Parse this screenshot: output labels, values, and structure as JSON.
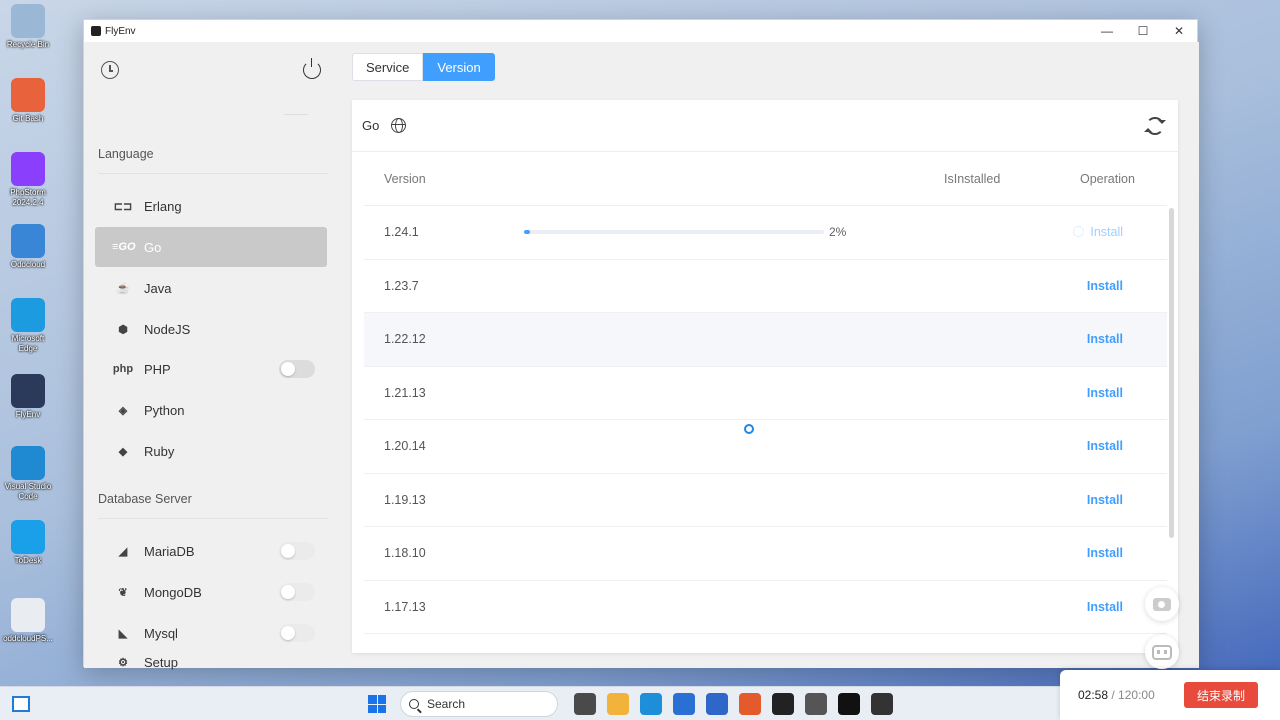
{
  "desktop": {
    "icons": [
      {
        "label": "Recycle Bin",
        "icon": "recycle-bin-icon",
        "color": "#9ab7d6"
      },
      {
        "label": "Git Bash",
        "icon": "git-bash-icon",
        "color": "#e8633b"
      },
      {
        "label": "PhpStorm 2024.2.4",
        "icon": "phpstorm-icon",
        "color": "#8a3ffc"
      },
      {
        "label": "Oddcloud",
        "icon": "oddcloud-icon",
        "color": "#3a86d6"
      },
      {
        "label": "Microsoft Edge",
        "icon": "edge-icon",
        "color": "#1c9be0"
      },
      {
        "label": "FlyEnv",
        "icon": "flyenv-icon",
        "color": "#2b3a5a"
      },
      {
        "label": "Visual Studio Code",
        "icon": "vscode-icon",
        "color": "#1f8ad2"
      },
      {
        "label": "ToDesk",
        "icon": "todesk-icon",
        "color": "#1aa0e8"
      },
      {
        "label": "oddcloudPS...",
        "icon": "file-icon",
        "color": "#e9edf2"
      }
    ]
  },
  "window": {
    "title": "FlyEnv",
    "controls": {
      "minimize": "—",
      "maximize": "☐",
      "close": "✕"
    }
  },
  "sidebar": {
    "sections": [
      {
        "title": "Language",
        "items": [
          {
            "label": "Erlang",
            "icon": "erlang-icon",
            "glyph": "⊏⊐",
            "active": false,
            "toggle": false
          },
          {
            "label": "Go",
            "icon": "go-icon",
            "glyph": "≡GO",
            "active": true,
            "toggle": false
          },
          {
            "label": "Java",
            "icon": "java-icon",
            "glyph": "☕",
            "active": false,
            "toggle": false
          },
          {
            "label": "NodeJS",
            "icon": "nodejs-icon",
            "glyph": "⬢",
            "active": false,
            "toggle": false
          },
          {
            "label": "PHP",
            "icon": "php-icon",
            "glyph": "php",
            "active": false,
            "toggle": true
          },
          {
            "label": "Python",
            "icon": "python-icon",
            "glyph": "◈",
            "active": false,
            "toggle": false
          },
          {
            "label": "Ruby",
            "icon": "ruby-icon",
            "glyph": "◆",
            "active": false,
            "toggle": false
          }
        ]
      },
      {
        "title": "Database Server",
        "items": [
          {
            "label": "MariaDB",
            "icon": "mariadb-icon",
            "glyph": "◢",
            "toggle": true
          },
          {
            "label": "MongoDB",
            "icon": "mongodb-icon",
            "glyph": "❦",
            "toggle": true
          },
          {
            "label": "Mysql",
            "icon": "mysql-icon",
            "glyph": "◣",
            "toggle": true
          }
        ]
      }
    ],
    "setup_label": "Setup"
  },
  "main": {
    "tabs": [
      {
        "label": "Service",
        "active": false
      },
      {
        "label": "Version",
        "active": true
      }
    ],
    "card": {
      "title": "Go",
      "columns": {
        "version": "Version",
        "installed": "IsInstalled",
        "operation": "Operation"
      },
      "rows": [
        {
          "version": "1.24.1",
          "progress": 2,
          "progress_label": "2%",
          "operation": "Install",
          "installing": true
        },
        {
          "version": "1.23.7",
          "operation": "Install"
        },
        {
          "version": "1.22.12",
          "operation": "Install",
          "hover": true
        },
        {
          "version": "1.21.13",
          "operation": "Install"
        },
        {
          "version": "1.20.14",
          "operation": "Install"
        },
        {
          "version": "1.19.13",
          "operation": "Install"
        },
        {
          "version": "1.18.10",
          "operation": "Install"
        },
        {
          "version": "1.17.13",
          "operation": "Install"
        }
      ]
    }
  },
  "taskbar": {
    "search_placeholder": "Search",
    "apps": [
      "file-explorer-icon",
      "edge-icon",
      "powershell-icon",
      "teamviewer-icon",
      "office-icon",
      "terminal-icon",
      "remote-icon",
      "qq-icon",
      "flyenv-icon",
      "cmd-icon"
    ]
  },
  "recorder": {
    "elapsed": "02:58",
    "separator": " / ",
    "total": "120:00",
    "stop_label": "结束录制"
  },
  "colors": {
    "accent": "#409eff",
    "record": "#e84a3c"
  }
}
